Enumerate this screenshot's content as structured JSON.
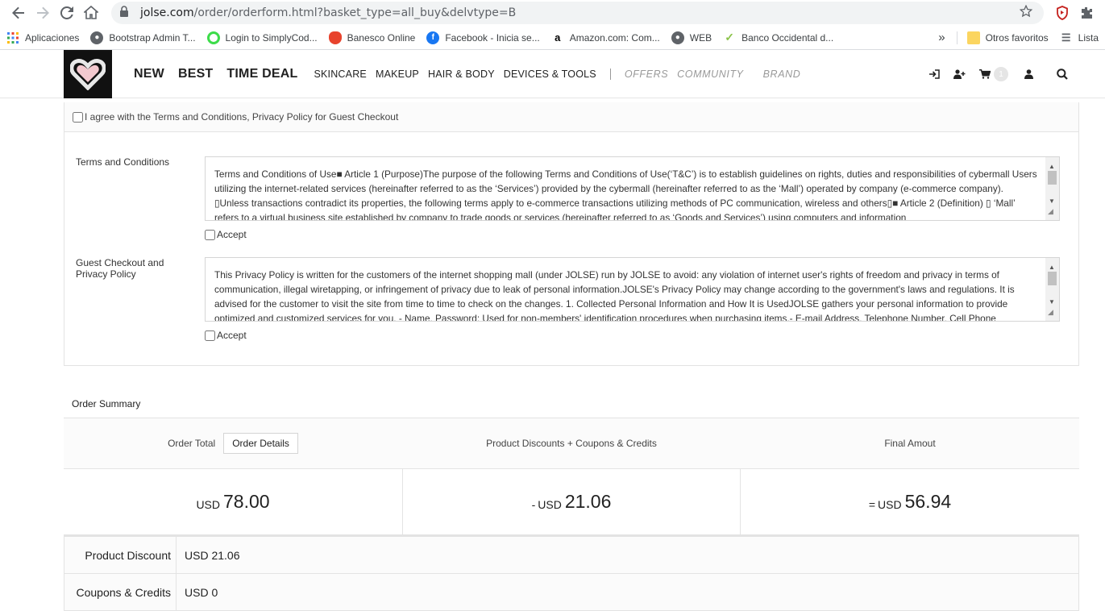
{
  "browser": {
    "url_host": "jolse.com",
    "url_path": "/order/orderform.html?basket_type=all_buy&delvtype=B",
    "bookmarks": [
      {
        "label": "Aplicaciones",
        "icon": "apps-grid-icon"
      },
      {
        "label": "Bootstrap Admin T...",
        "icon": "globe-icon"
      },
      {
        "label": "Login to SimplyCod...",
        "icon": "simplycode-icon"
      },
      {
        "label": "Banesco Online",
        "icon": "banesco-icon"
      },
      {
        "label": "Facebook - Inicia se...",
        "icon": "facebook-icon"
      },
      {
        "label": "Amazon.com: Com...",
        "icon": "amazon-icon"
      },
      {
        "label": "WEB",
        "icon": "globe-icon"
      },
      {
        "label": "Banco Occidental d...",
        "icon": "bod-icon"
      }
    ],
    "overflow_label": "»",
    "other_favorites": "Otros favoritos",
    "reading_list": "Lista"
  },
  "site": {
    "nav_big": [
      "NEW",
      "BEST",
      "TIME DEAL"
    ],
    "nav_categories": [
      "SKINCARE",
      "MAKEUP",
      "HAIR & BODY",
      "DEVICES & TOOLS"
    ],
    "nav_soft": [
      "OFFERS",
      "COMMUNITY"
    ],
    "nav_brand": "BRAND",
    "cart_count": "1"
  },
  "agreement": {
    "all_agree_label": "I agree with the Terms and Conditions, Privacy Policy for Guest Checkout",
    "terms_label": "Terms and Conditions",
    "terms_text": "Terms and Conditions of Use■ Article 1 (Purpose)The purpose of the following Terms and Conditions of Use(‘T&C’) is to establish guidelines on rights, duties and responsibilities of cybermall Users utilizing the internet-related services (hereinafter referred to as the ‘Services’) provided by the      cybermall (hereinafter referred to as the ‘Mall’) operated by      company (e-commerce company). ▯Unless transactions contradict its properties, the following terms apply to e-commerce transactions utilizing methods of PC communication, wireless and others▯■ Article 2 (Definition) ▯ ‘Mall’ refers to a virtual business site established by      company to trade goods or services (hereinafter referred to as ‘Goods and Services’) using computers and information",
    "privacy_label": "Guest Checkout and Privacy Policy",
    "privacy_text": "This Privacy Policy is written for the customers of the internet shopping mall (under JOLSE) run by JOLSE to avoid: any violation of internet user's rights of freedom and privacy in terms of communication, illegal wiretapping, or infringement of privacy due to leak of personal information.JOLSE's Privacy Policy may change according to the government's laws and regulations. It is advised for the customer to visit the site from time to time to check on the changes. 1. Collected Personal Information and How It is UsedJOLSE gathers your personal information to provide optimized and customized services for you. - Name, Password: Used for non-members' identification procedures when purchasing items.- E-mail Address, Telephone Number, Cell Phone",
    "accept_label": "Accept"
  },
  "summary": {
    "title": "Order Summary",
    "order_total_label": "Order Total",
    "order_details_button": "Order Details",
    "discounts_label": "Product Discounts + Coupons & Credits",
    "final_label": "Final Amout",
    "currency": "USD",
    "order_total": "78.00",
    "discount_prefix": "-",
    "discount_total": "21.06",
    "final_prefix": "=",
    "final_total": "56.94",
    "rows": [
      {
        "label": "Product Discount",
        "value": "USD 21.06"
      },
      {
        "label": "Coupons & Credits",
        "value": "USD 0"
      }
    ]
  }
}
